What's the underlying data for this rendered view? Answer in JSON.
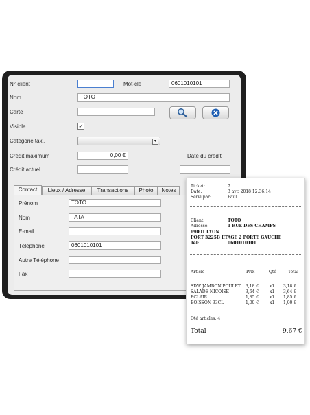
{
  "form": {
    "n_client_label": "N° client",
    "n_client_value": "",
    "motcle_label": "Mot-clé",
    "motcle_value": "0601010101",
    "nom_label": "Nom",
    "nom_value": "TOTO",
    "carte_label": "Carte",
    "carte_value": "",
    "visible_label": "Visible",
    "visible_check": "✓",
    "categorie_label": "Catégorie tax..",
    "credit_max_label": "Crédit maximum",
    "credit_max_value": "0,00 €",
    "date_credit_label": "Date du crédit",
    "credit_actuel_label": "Crédit actuel",
    "search_icon": "search-icon",
    "close_icon": "close-icon"
  },
  "tabs": [
    "Contact",
    "Lieux / Adresse",
    "Transactions",
    "Photo",
    "Notes"
  ],
  "contact": {
    "prenom_label": "Prénom",
    "prenom_value": "TOTO",
    "nom_label": "Nom",
    "nom_value": "TATA",
    "email_label": "E-mail",
    "email_value": "",
    "telephone_label": "Téléphone",
    "telephone_value": "0601010101",
    "autre_tel_label": "Autre Téléphone",
    "autre_tel_value": "",
    "fax_label": "Fax",
    "fax_value": ""
  },
  "receipt": {
    "ticket_label": "Ticket:",
    "ticket_value": "7",
    "date_label": "Date:",
    "date_value": "3 avr. 2018 12:36:14",
    "servi_label": "Servi par:",
    "servi_value": "Paul",
    "client_label": "Client:",
    "client_value": "TOTO",
    "adresse_label": "Adresse:",
    "adresse_line1": "1 RUE DES CHAMPS",
    "adresse_line2": "69001 LYON",
    "adresse_line3": "PORT 3225B ETAGE 2 PORTE GAUCHE",
    "tel_label": "Tél:",
    "tel_value": "0601010101",
    "col_article": "Article",
    "col_prix": "Prix",
    "col_qte": "Qté",
    "col_total": "Total",
    "items": [
      {
        "name": "SDW JAMBON POULET",
        "price": "3,18 €",
        "qty": "x1",
        "total": "3,18 €"
      },
      {
        "name": "SALADE NICOISE",
        "price": "3,64 €",
        "qty": "x1",
        "total": "3,64 €"
      },
      {
        "name": "ECLAIR",
        "price": "1,85 €",
        "qty": "x1",
        "total": "1,85 €"
      },
      {
        "name": "BOISSON 33CL",
        "price": "1,00 €",
        "qty": "x1",
        "total": "1,00 €"
      }
    ],
    "qte_articles": "Qté articles: 4",
    "total_label": "Total",
    "total_value": "9,67 €"
  }
}
